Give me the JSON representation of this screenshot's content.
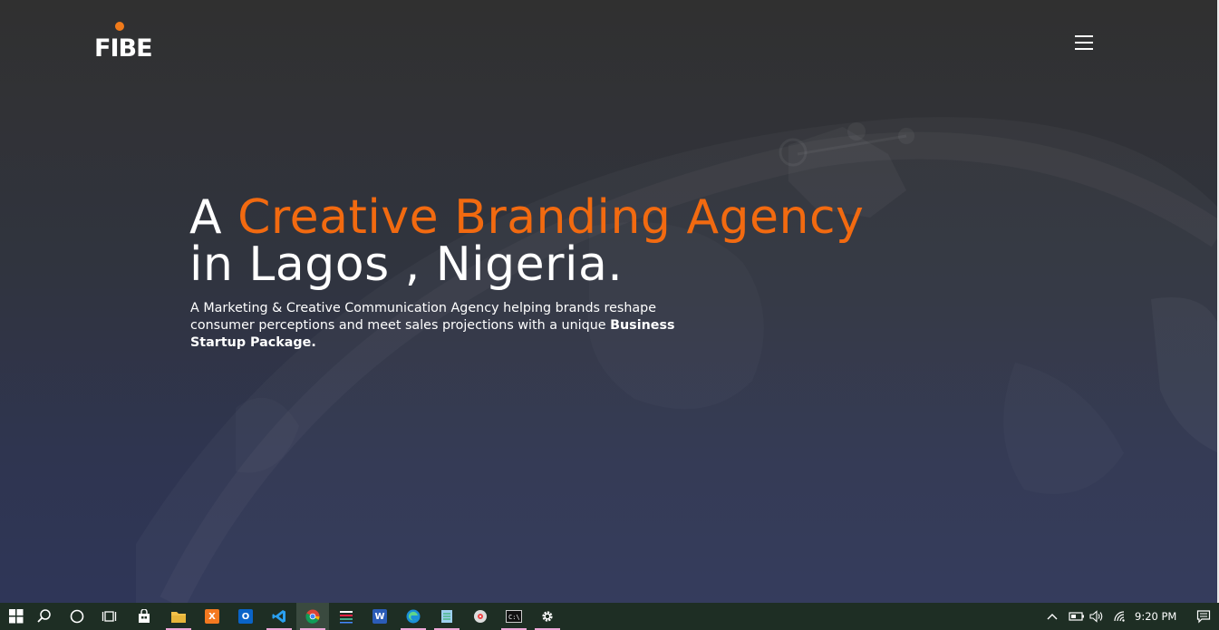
{
  "header": {
    "logo_text": "FIBE",
    "menu_icon": "hamburger-menu-icon"
  },
  "hero": {
    "headline_prefix": "A ",
    "headline_accent": "Creative Branding Agency",
    "headline_line2": "in Lagos , Nigeria.",
    "sub_normal": "A Marketing & Creative Communication Agency helping brands reshape consumer perceptions and meet sales projections with a unique ",
    "sub_bold": "Business Startup Package."
  },
  "colors": {
    "accent": "#f26a10",
    "bg_top": "#303030",
    "bg_bottom": "#2f3658",
    "taskbar": "#1e2e24"
  },
  "taskbar": {
    "icons": [
      "windows-start-icon",
      "search-icon",
      "cortana-icon",
      "task-view-icon",
      "store-icon",
      "file-explorer-icon",
      "xampp-icon",
      "outlook-icon",
      "vscode-icon",
      "chrome-icon",
      "app-icon",
      "word-icon",
      "edge-icon",
      "notepad-icon",
      "media-icon",
      "terminal-icon",
      "settings-icon"
    ],
    "tray_icons": [
      "chevron-up-icon",
      "battery-icon",
      "volume-icon",
      "wifi-icon"
    ],
    "clock": "9:20 PM",
    "notification_icon": "notification-icon"
  }
}
